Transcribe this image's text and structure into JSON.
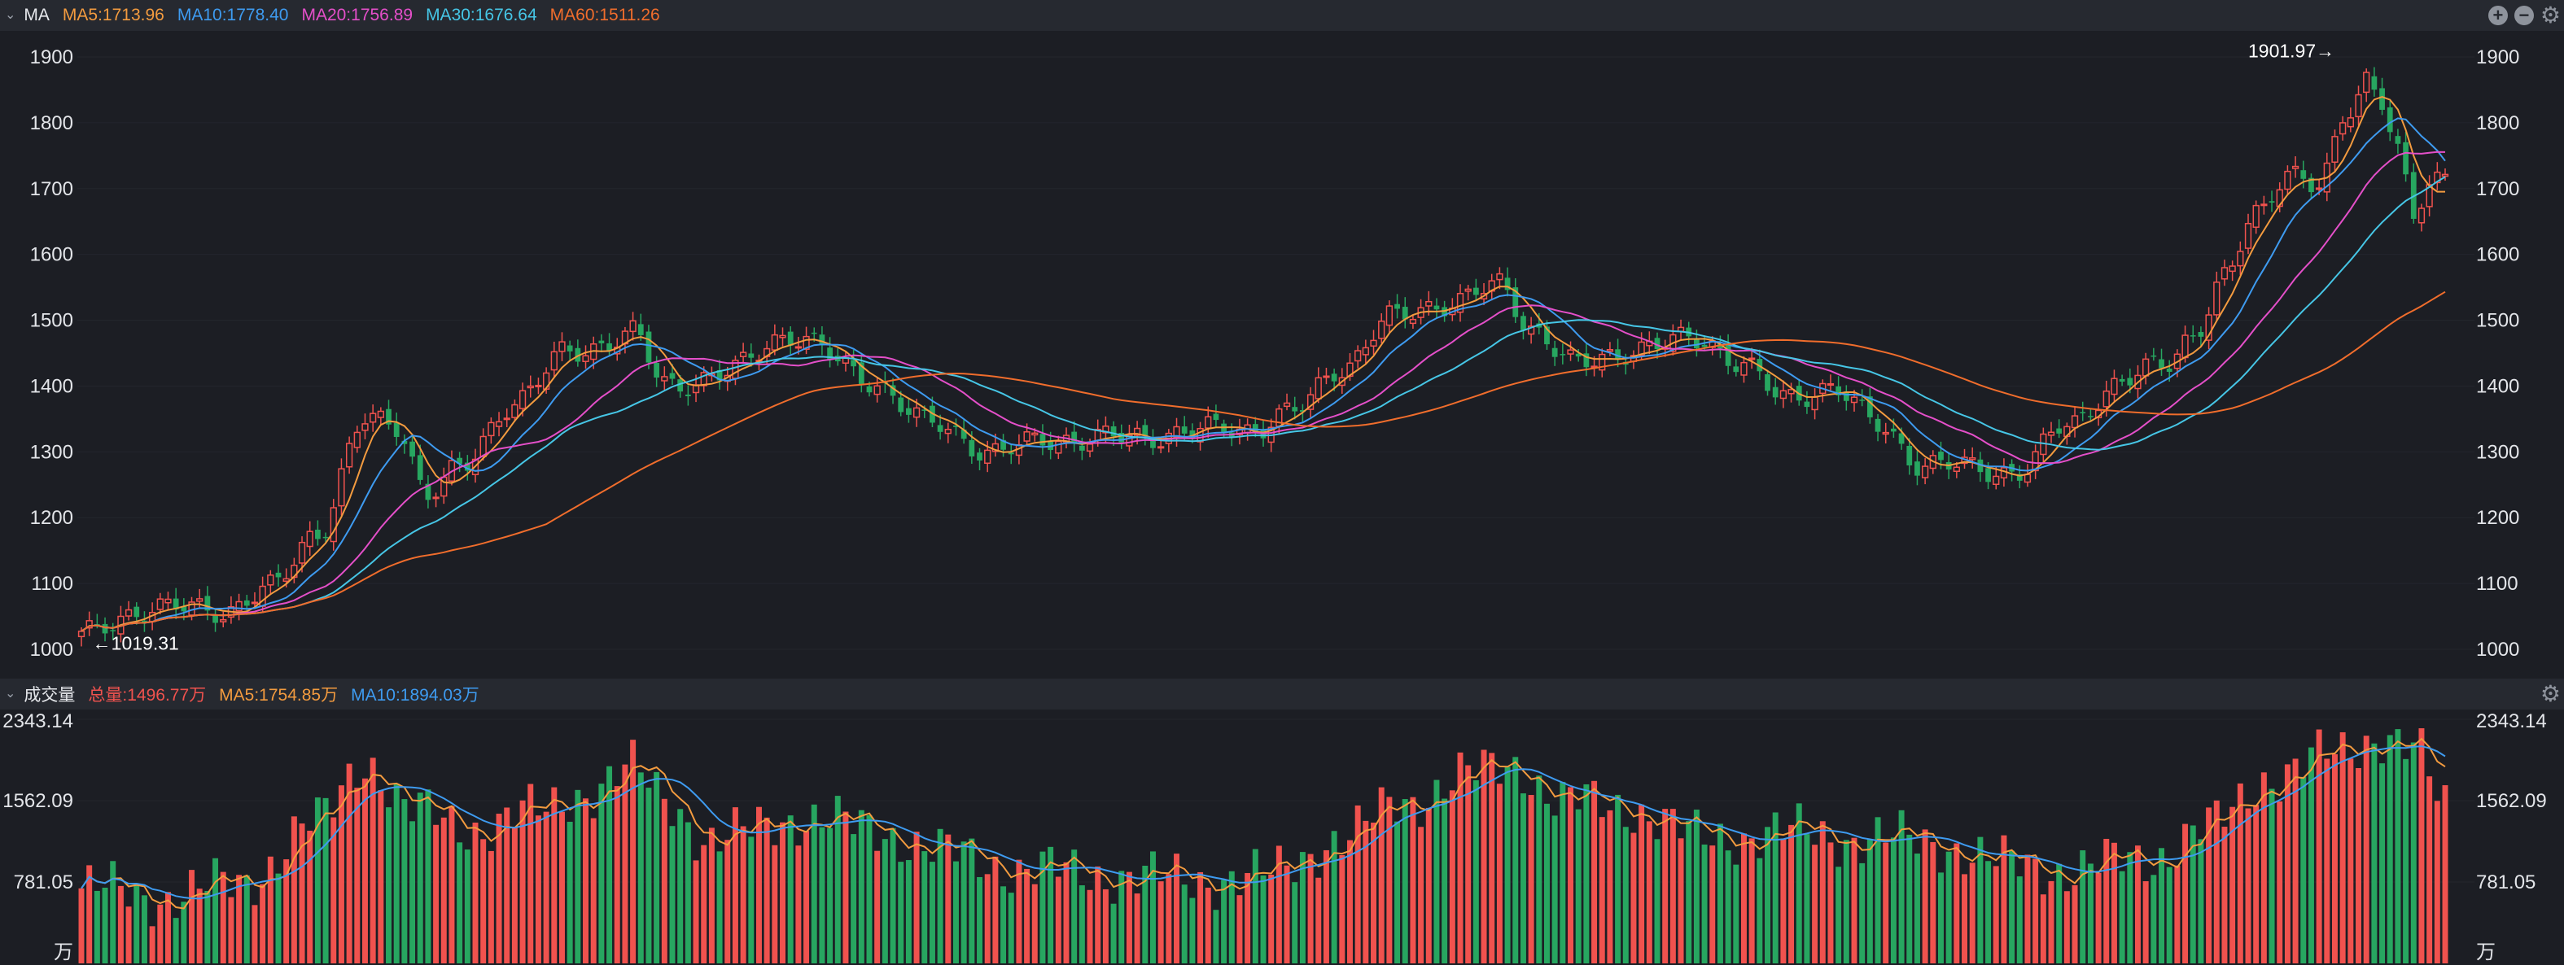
{
  "price_header": {
    "title": "MA",
    "items": [
      {
        "text": "MA5:1713.96",
        "color": "#f39b3f"
      },
      {
        "text": "MA10:1778.40",
        "color": "#3e9bf0"
      },
      {
        "text": "MA20:1756.89",
        "color": "#e44fc9"
      },
      {
        "text": "MA30:1676.64",
        "color": "#46c6e6"
      },
      {
        "text": "MA60:1511.26",
        "color": "#f06d2c"
      }
    ],
    "icons": [
      "add-icon",
      "minus-icon",
      "gear-icon"
    ]
  },
  "volume_header": {
    "title": "成交量",
    "items": [
      {
        "text": "总量:1496.77万",
        "color": "#f0524e"
      },
      {
        "text": "MA5:1754.85万",
        "color": "#f39b3f"
      },
      {
        "text": "MA10:1894.03万",
        "color": "#3e9bf0"
      }
    ],
    "icons": [
      "gear-icon"
    ]
  },
  "price_axis": {
    "ticks": [
      "1900",
      "1800",
      "1700",
      "1600",
      "1500",
      "1400",
      "1300",
      "1200",
      "1100",
      "1000"
    ]
  },
  "volume_axis": {
    "ticks": [
      "2343.14",
      "1562.09",
      "781.05"
    ],
    "unit": "万"
  },
  "annotations": {
    "high": "1901.97→",
    "low": "←1019.31"
  },
  "colors": {
    "up": "#f0524e",
    "down": "#27a660",
    "background": "#1c1e24",
    "header": "#262930"
  },
  "chart_data": [
    {
      "type": "candlestick",
      "title": "MA",
      "ylim": [
        980,
        1915
      ],
      "anchors": [
        {
          "i": 0,
          "close": 1019
        },
        {
          "i": 8,
          "close": 1062
        },
        {
          "i": 18,
          "close": 1060
        },
        {
          "i": 24,
          "close": 1090
        },
        {
          "i": 30,
          "close": 1180
        },
        {
          "i": 36,
          "close": 1345
        },
        {
          "i": 40,
          "close": 1340
        },
        {
          "i": 44,
          "close": 1240
        },
        {
          "i": 48,
          "close": 1270
        },
        {
          "i": 55,
          "close": 1380
        },
        {
          "i": 62,
          "close": 1450
        },
        {
          "i": 70,
          "close": 1480
        },
        {
          "i": 74,
          "close": 1400
        },
        {
          "i": 82,
          "close": 1420
        },
        {
          "i": 90,
          "close": 1480
        },
        {
          "i": 100,
          "close": 1410
        },
        {
          "i": 108,
          "close": 1340
        },
        {
          "i": 116,
          "close": 1300
        },
        {
          "i": 124,
          "close": 1320
        },
        {
          "i": 132,
          "close": 1320
        },
        {
          "i": 140,
          "close": 1330
        },
        {
          "i": 148,
          "close": 1335
        },
        {
          "i": 154,
          "close": 1360
        },
        {
          "i": 160,
          "close": 1430
        },
        {
          "i": 166,
          "close": 1500
        },
        {
          "i": 174,
          "close": 1530
        },
        {
          "i": 180,
          "close": 1550
        },
        {
          "i": 184,
          "close": 1490
        },
        {
          "i": 190,
          "close": 1430
        },
        {
          "i": 198,
          "close": 1460
        },
        {
          "i": 206,
          "close": 1470
        },
        {
          "i": 210,
          "close": 1440
        },
        {
          "i": 216,
          "close": 1380
        },
        {
          "i": 222,
          "close": 1400
        },
        {
          "i": 228,
          "close": 1340
        },
        {
          "i": 234,
          "close": 1280
        },
        {
          "i": 240,
          "close": 1275
        },
        {
          "i": 246,
          "close": 1270
        },
        {
          "i": 252,
          "close": 1340
        },
        {
          "i": 258,
          "close": 1400
        },
        {
          "i": 264,
          "close": 1430
        },
        {
          "i": 268,
          "close": 1480
        },
        {
          "i": 272,
          "close": 1560
        },
        {
          "i": 276,
          "close": 1660
        },
        {
          "i": 280,
          "close": 1730
        },
        {
          "i": 284,
          "close": 1700
        },
        {
          "i": 288,
          "close": 1820
        },
        {
          "i": 290,
          "close": 1870
        },
        {
          "i": 292,
          "close": 1840
        },
        {
          "i": 294,
          "close": 1760
        },
        {
          "i": 296,
          "close": 1650
        },
        {
          "i": 298,
          "close": 1700
        },
        {
          "i": 300,
          "close": 1714
        }
      ],
      "count": 301,
      "high": 1901.97,
      "low": 1019.31,
      "series": [
        {
          "name": "MA5",
          "window": 5,
          "color": "#f39b3f",
          "last": 1713.96
        },
        {
          "name": "MA10",
          "window": 10,
          "color": "#3e9bf0",
          "last": 1778.4
        },
        {
          "name": "MA20",
          "window": 20,
          "color": "#e44fc9",
          "last": 1756.89
        },
        {
          "name": "MA30",
          "window": 30,
          "color": "#46c6e6",
          "last": 1676.64
        },
        {
          "name": "MA60",
          "window": 60,
          "color": "#f06d2c",
          "last": 1511.26
        }
      ]
    },
    {
      "type": "bar",
      "title": "成交量",
      "unit": "万",
      "ylim": [
        0,
        2343.14
      ],
      "total_last": 1496.77,
      "anchors": [
        {
          "i": 0,
          "v": 720
        },
        {
          "i": 10,
          "v": 640
        },
        {
          "i": 20,
          "v": 760
        },
        {
          "i": 30,
          "v": 1350
        },
        {
          "i": 36,
          "v": 1950
        },
        {
          "i": 42,
          "v": 1450
        },
        {
          "i": 50,
          "v": 1300
        },
        {
          "i": 58,
          "v": 1450
        },
        {
          "i": 64,
          "v": 1650
        },
        {
          "i": 70,
          "v": 1850
        },
        {
          "i": 74,
          "v": 1600
        },
        {
          "i": 80,
          "v": 1150
        },
        {
          "i": 90,
          "v": 1400
        },
        {
          "i": 100,
          "v": 1300
        },
        {
          "i": 110,
          "v": 1050
        },
        {
          "i": 120,
          "v": 900
        },
        {
          "i": 130,
          "v": 850
        },
        {
          "i": 140,
          "v": 800
        },
        {
          "i": 150,
          "v": 830
        },
        {
          "i": 160,
          "v": 1200
        },
        {
          "i": 168,
          "v": 1550
        },
        {
          "i": 176,
          "v": 1800
        },
        {
          "i": 182,
          "v": 1900
        },
        {
          "i": 188,
          "v": 1550
        },
        {
          "i": 196,
          "v": 1500
        },
        {
          "i": 206,
          "v": 1200
        },
        {
          "i": 216,
          "v": 1250
        },
        {
          "i": 226,
          "v": 1200
        },
        {
          "i": 236,
          "v": 1150
        },
        {
          "i": 244,
          "v": 950
        },
        {
          "i": 252,
          "v": 900
        },
        {
          "i": 262,
          "v": 1000
        },
        {
          "i": 270,
          "v": 1300
        },
        {
          "i": 278,
          "v": 1800
        },
        {
          "i": 286,
          "v": 2000
        },
        {
          "i": 292,
          "v": 2200
        },
        {
          "i": 296,
          "v": 2050
        },
        {
          "i": 300,
          "v": 1497
        }
      ],
      "series": [
        {
          "name": "MA5",
          "window": 5,
          "color": "#f39b3f",
          "last": 1754.85
        },
        {
          "name": "MA10",
          "window": 10,
          "color": "#3e9bf0",
          "last": 1894.03
        }
      ]
    }
  ]
}
